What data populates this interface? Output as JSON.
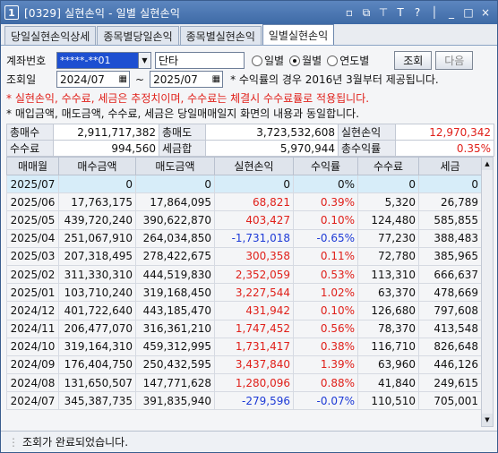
{
  "window": {
    "title": "[0329] 실현손익 - 일별 실현손익",
    "app_icon": "1",
    "controls": [
      "▫",
      "⧉",
      "⊤",
      "T",
      "?",
      "│",
      "_",
      "□",
      "×"
    ]
  },
  "tabs": [
    "당일실현손익상세",
    "종목별당일손익",
    "종목별실현손익",
    "일별실현손익"
  ],
  "active_tab": 3,
  "filters": {
    "account_label": "계좌번호",
    "account_value": "*****-**01",
    "account_name": "단타",
    "period_options": [
      "일별",
      "월별",
      "연도별"
    ],
    "period_selected": 1,
    "query_label": "조회",
    "next_label": "다음",
    "date_label": "조회일",
    "date_from": "2024/07",
    "date_to": "2025/07",
    "date_sep": "~",
    "date_note": "* 수익률의 경우 2016년 3월부터 제공됩니다."
  },
  "notes": [
    "* 실현손익, 수수료, 세금은 추정치이며, 수수료는 체결시 수수료률로 적용됩니다.",
    "* 매입금액, 매도금액, 수수료, 세금은 당일매매일지 화면의 내용과 동일합니다."
  ],
  "summary": {
    "buy_total_label": "총매수",
    "buy_total": "2,911,717,382",
    "sell_total_label": "총매도",
    "sell_total": "3,723,532,608",
    "realized_label": "실현손익",
    "realized": "12,970,342",
    "fee_label": "수수료",
    "fee": "994,560",
    "tax_label": "세금합",
    "tax": "5,970,944",
    "return_label": "총수익률",
    "return": "0.35%"
  },
  "grid": {
    "headers": [
      "매매월",
      "매수금액",
      "매도금액",
      "실현손익",
      "수익률",
      "수수료",
      "세금"
    ],
    "rows": [
      [
        "2025/07",
        "0",
        "0",
        "0",
        "0%",
        "0",
        "0"
      ],
      [
        "2025/06",
        "17,763,175",
        "17,864,095",
        "68,821",
        "0.39%",
        "5,320",
        "26,789"
      ],
      [
        "2025/05",
        "439,720,240",
        "390,622,870",
        "403,427",
        "0.10%",
        "124,480",
        "585,855"
      ],
      [
        "2025/04",
        "251,067,910",
        "264,034,850",
        "-1,731,018",
        "-0.65%",
        "77,230",
        "388,483"
      ],
      [
        "2025/03",
        "207,318,495",
        "278,422,675",
        "300,358",
        "0.11%",
        "72,780",
        "385,965"
      ],
      [
        "2025/02",
        "311,330,310",
        "444,519,830",
        "2,352,059",
        "0.53%",
        "113,310",
        "666,637"
      ],
      [
        "2025/01",
        "103,710,240",
        "319,168,450",
        "3,227,544",
        "1.02%",
        "63,370",
        "478,669"
      ],
      [
        "2024/12",
        "401,722,640",
        "443,185,470",
        "431,942",
        "0.10%",
        "126,680",
        "797,608"
      ],
      [
        "2024/11",
        "206,477,070",
        "316,361,210",
        "1,747,452",
        "0.56%",
        "78,370",
        "413,548"
      ],
      [
        "2024/10",
        "319,164,310",
        "459,312,995",
        "1,731,417",
        "0.38%",
        "116,710",
        "826,648"
      ],
      [
        "2024/09",
        "176,404,750",
        "250,432,595",
        "3,437,840",
        "1.39%",
        "63,960",
        "446,126"
      ],
      [
        "2024/08",
        "131,650,507",
        "147,771,628",
        "1,280,096",
        "0.88%",
        "41,840",
        "249,615"
      ],
      [
        "2024/07",
        "345,387,735",
        "391,835,940",
        "-279,596",
        "-0.07%",
        "110,510",
        "705,001"
      ]
    ],
    "highlight_row": 0
  },
  "status_text": "조회가 완료되었습니다.",
  "colors": {
    "positive": "#e0201a",
    "negative": "#1d3ad6",
    "title": "#3e6aa6",
    "highlight": "#d7edf9"
  }
}
